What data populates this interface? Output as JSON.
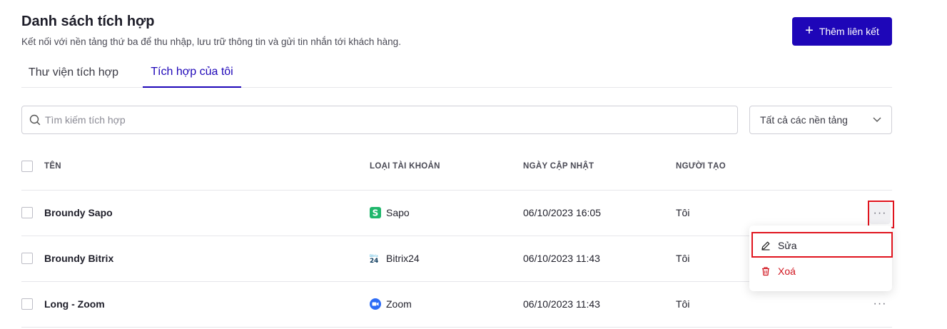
{
  "header": {
    "title": "Danh sách tích hợp",
    "subtitle": "Kết nối với nền tảng thứ ba để thu nhập, lưu trữ thông tin và gửi tin nhắn tới khách hàng.",
    "add_button_label": "Thêm liên kết"
  },
  "tabs": [
    {
      "label": "Thư viện tích hợp",
      "active": false
    },
    {
      "label": "Tích hợp của tôi",
      "active": true
    }
  ],
  "search": {
    "placeholder": "Tìm kiếm tích hợp",
    "value": ""
  },
  "platform_filter": {
    "selected": "Tất cả các nền tảng"
  },
  "table": {
    "headers": {
      "name": "TÊN",
      "account_type": "LOẠI TÀI KHOẢN",
      "updated": "NGÀY CẬP NHẬT",
      "creator": "NGƯỜI TẠO"
    },
    "rows": [
      {
        "name": "Broundy Sapo",
        "account": "Sapo",
        "account_icon": "sapo-logo-icon",
        "updated": "06/10/2023 16:05",
        "creator": "Tôi"
      },
      {
        "name": "Broundy Bitrix",
        "account": "Bitrix24",
        "account_icon": "bitrix24-logo-icon",
        "updated": "06/10/2023 11:43",
        "creator": "Tôi"
      },
      {
        "name": "Long - Zoom",
        "account": "Zoom",
        "account_icon": "zoom-logo-icon",
        "updated": "06/10/2023 11:43",
        "creator": "Tôi"
      }
    ]
  },
  "row_menu": {
    "edit_label": "Sửa",
    "delete_label": "Xoá"
  },
  "colors": {
    "primary": "#1e06b8",
    "danger": "#d0141e",
    "highlight": "#e0141e",
    "sapo": "#1fb76b",
    "zoom": "#2d6cf6"
  }
}
